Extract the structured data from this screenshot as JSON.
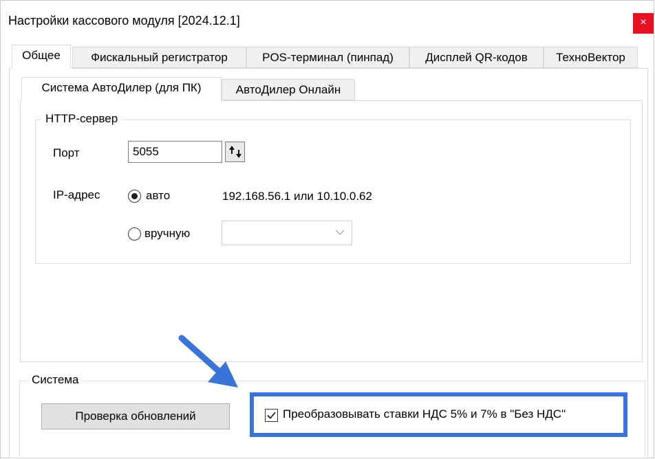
{
  "window": {
    "title": "Настройки кассового модуля [2024.12.1]",
    "close_glyph": "×"
  },
  "tabs": [
    {
      "label": "Общее",
      "active": true
    },
    {
      "label": "Фискальный регистратор",
      "active": false
    },
    {
      "label": "POS-терминал (пинпад)",
      "active": false
    },
    {
      "label": "Дисплей QR-кодов",
      "active": false
    },
    {
      "label": "ТехноВектор",
      "active": false
    }
  ],
  "subtabs": [
    {
      "label": "Система АвтоДилер (для ПК)",
      "active": true
    },
    {
      "label": "АвтоДилер Онлайн",
      "active": false
    }
  ],
  "http_server": {
    "group_label": "HTTP-сервер",
    "port_label": "Порт",
    "port_value": "5055",
    "ip_label": "IP-адрес",
    "radio_auto_label": "авто",
    "radio_auto_checked": true,
    "ip_value": "192.168.56.1 или 10.10.0.62",
    "radio_manual_label": "вручную",
    "radio_manual_checked": false,
    "manual_select_value": ""
  },
  "system": {
    "group_label": "Система",
    "update_button_label": "Проверка обновлений",
    "vat_checkbox_label": "Преобразовывать ставки НДС 5% и 7% в \"Без НДС\"",
    "vat_checkbox_checked": true
  },
  "annotation": {
    "highlight_color": "#3a74d6",
    "arrow_color": "#3a74d6"
  },
  "icons": {
    "spin": "spin-arrows-icon",
    "chevron": "chevron-down-icon",
    "check": "checkmark-icon"
  }
}
